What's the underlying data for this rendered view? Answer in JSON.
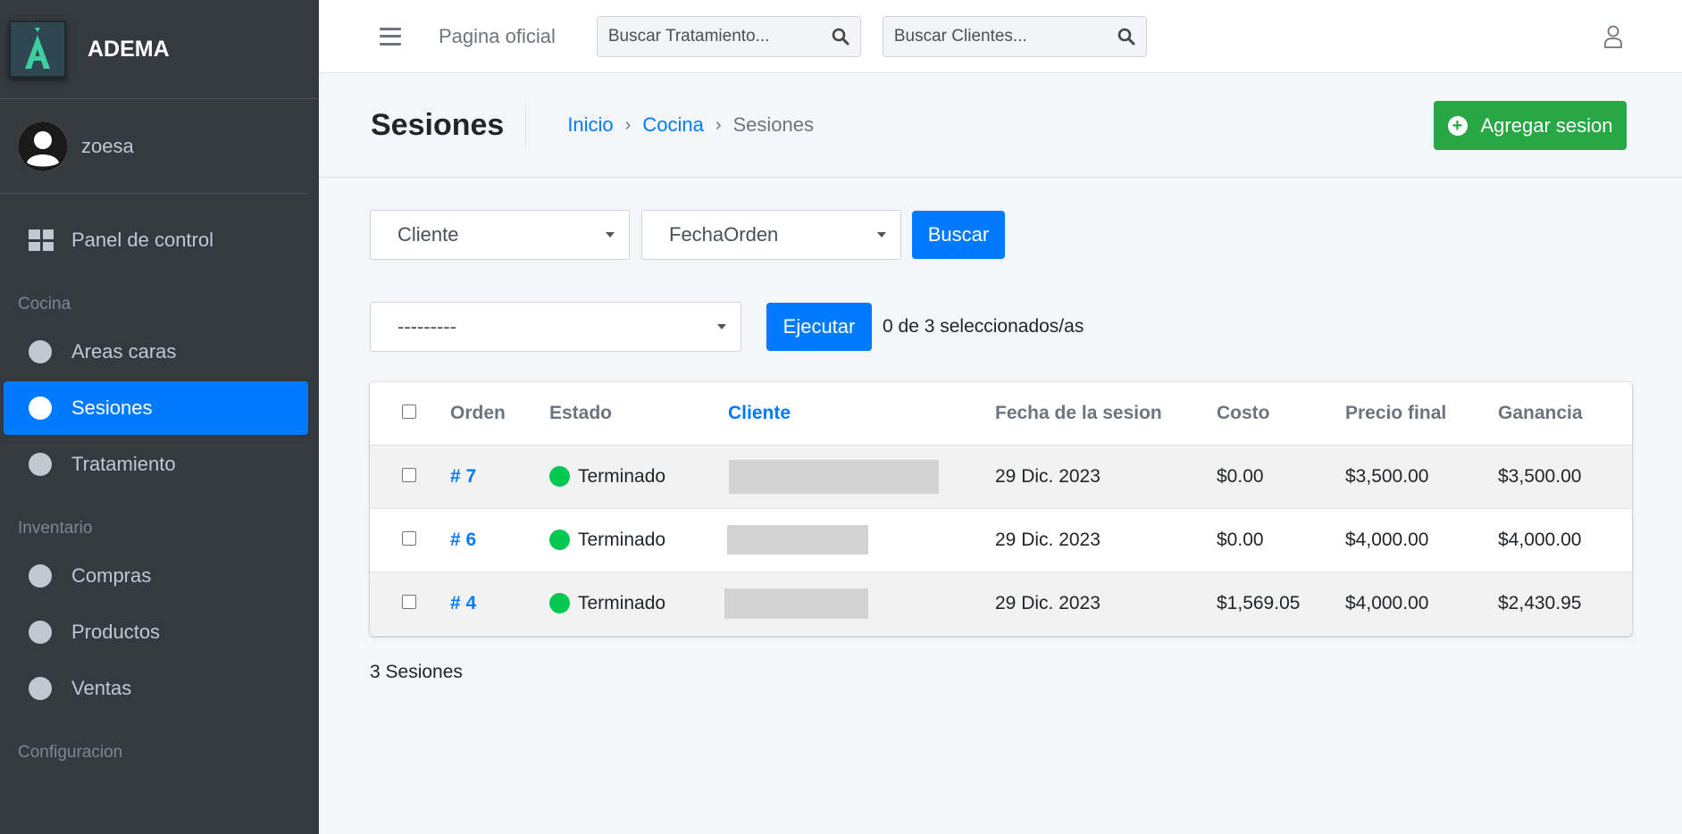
{
  "brand": {
    "name": "ADEMA",
    "logo_letter": "A"
  },
  "user": {
    "name": "zoesa"
  },
  "sidebar": {
    "dashboard_label": "Panel de control",
    "sections": [
      {
        "header": "Cocina",
        "items": [
          {
            "label": "Areas caras"
          },
          {
            "label": "Sesiones"
          },
          {
            "label": "Tratamiento"
          }
        ]
      },
      {
        "header": "Inventario",
        "items": [
          {
            "label": "Compras"
          },
          {
            "label": "Productos"
          },
          {
            "label": "Ventas"
          }
        ]
      },
      {
        "header": "Configuracion"
      }
    ],
    "active_item": "Sesiones"
  },
  "topbar": {
    "official_page_link": "Pagina oficial",
    "search_treatment_placeholder": "Buscar Tratamiento...",
    "search_clients_placeholder": "Buscar Clientes..."
  },
  "header": {
    "title": "Sesiones",
    "breadcrumb": [
      "Inicio",
      "Cocina",
      "Sesiones"
    ],
    "breadcrumb_separator": "›",
    "add_button": "Agregar sesion"
  },
  "filters": {
    "client_select": "Cliente",
    "date_select": "FechaOrden",
    "search_button": "Buscar"
  },
  "actions": {
    "action_select": "---------",
    "execute_button": "Ejecutar",
    "selected_text": "0 de 3 seleccionados/as"
  },
  "table": {
    "columns": [
      "Orden",
      "Estado",
      "Cliente",
      "Fecha de la sesion",
      "Costo",
      "Precio final",
      "Ganancia"
    ],
    "rows": [
      {
        "orden": "# 7",
        "estado": "Terminado",
        "fecha": "29 Dic. 2023",
        "costo": "$0.00",
        "precio": "$3,500.00",
        "ganancia": "$3,500.00"
      },
      {
        "orden": "# 6",
        "estado": "Terminado",
        "fecha": "29 Dic. 2023",
        "costo": "$0.00",
        "precio": "$4,000.00",
        "ganancia": "$4,000.00"
      },
      {
        "orden": "# 4",
        "estado": "Terminado",
        "fecha": "29 Dic. 2023",
        "costo": "$1,569.05",
        "precio": "$4,000.00",
        "ganancia": "$2,430.95"
      }
    ]
  },
  "footer": {
    "count_text": "3 Sesiones"
  },
  "colors": {
    "sidebar_bg": "#343a40",
    "primary": "#007bff",
    "success": "#28a745",
    "status_done": "#00c851"
  }
}
